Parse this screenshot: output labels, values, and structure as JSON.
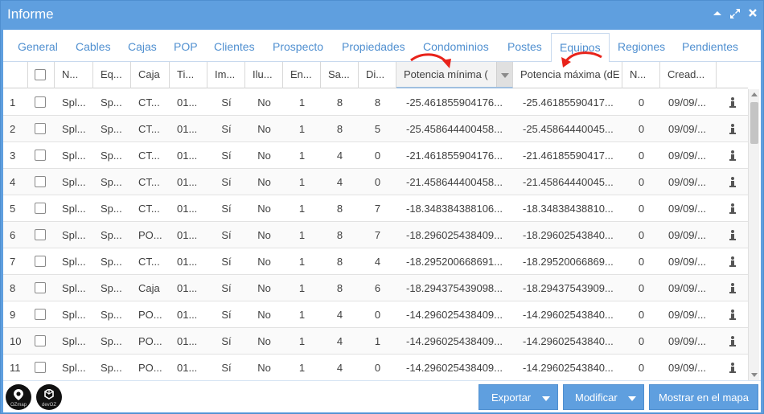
{
  "window": {
    "title": "Informe"
  },
  "titlebar_tools": [
    "collapse-icon",
    "expand-icon",
    "close-icon"
  ],
  "tabs": [
    "General",
    "Cables",
    "Cajas",
    "POP",
    "Clientes",
    "Prospecto",
    "Propiedades",
    "Condominios",
    "Postes",
    "Equipos",
    "Regiones",
    "Pendientes"
  ],
  "active_tab": "Equipos",
  "columns": [
    "N...",
    "Eq...",
    "Caja",
    "Ti...",
    "Im...",
    "Ilu...",
    "En...",
    "Sa...",
    "Di...",
    "Potencia mínima (",
    "Potencia máxima (dE",
    "N...",
    "Cread..."
  ],
  "rows": [
    [
      "1",
      "Spl...",
      "Sp...",
      "CT...",
      "01...",
      "Sí",
      "No",
      "1",
      "8",
      "8",
      "-25.461855904176...",
      "-25.46185590417...",
      "0",
      "09/09/..."
    ],
    [
      "2",
      "Spl...",
      "Sp...",
      "CT...",
      "01...",
      "Sí",
      "No",
      "1",
      "8",
      "5",
      "-25.458644400458...",
      "-25.45864440045...",
      "0",
      "09/09/..."
    ],
    [
      "3",
      "Spl...",
      "Sp...",
      "CT...",
      "01...",
      "Sí",
      "No",
      "1",
      "4",
      "0",
      "-21.461855904176...",
      "-21.46185590417...",
      "0",
      "09/09/..."
    ],
    [
      "4",
      "Spl...",
      "Sp...",
      "CT...",
      "01...",
      "Sí",
      "No",
      "1",
      "4",
      "0",
      "-21.458644400458...",
      "-21.45864440045...",
      "0",
      "09/09/..."
    ],
    [
      "5",
      "Spl...",
      "Sp...",
      "CT...",
      "01...",
      "Sí",
      "No",
      "1",
      "8",
      "7",
      "-18.348384388106...",
      "-18.34838438810...",
      "0",
      "09/09/..."
    ],
    [
      "6",
      "Spl...",
      "Sp...",
      "PO...",
      "01...",
      "Sí",
      "No",
      "1",
      "8",
      "7",
      "-18.296025438409...",
      "-18.29602543840...",
      "0",
      "09/09/..."
    ],
    [
      "7",
      "Spl...",
      "Sp...",
      "CT...",
      "01...",
      "Sí",
      "No",
      "1",
      "8",
      "4",
      "-18.295200668691...",
      "-18.29520066869...",
      "0",
      "09/09/..."
    ],
    [
      "8",
      "Spl...",
      "Sp...",
      "Caja",
      "01...",
      "Sí",
      "No",
      "1",
      "8",
      "6",
      "-18.294375439098...",
      "-18.29437543909...",
      "0",
      "09/09/..."
    ],
    [
      "9",
      "Spl...",
      "Sp...",
      "PO...",
      "01...",
      "Sí",
      "No",
      "1",
      "4",
      "0",
      "-14.296025438409...",
      "-14.29602543840...",
      "0",
      "09/09/..."
    ],
    [
      "10",
      "Spl...",
      "Sp...",
      "PO...",
      "01...",
      "Sí",
      "No",
      "1",
      "4",
      "1",
      "-14.296025438409...",
      "-14.29602543840...",
      "0",
      "09/09/..."
    ],
    [
      "11",
      "Spl...",
      "Sp...",
      "PO...",
      "01...",
      "Sí",
      "No",
      "1",
      "4",
      "0",
      "-14.296025438409...",
      "-14.29602543840...",
      "0",
      "09/09/..."
    ]
  ],
  "footer": {
    "logos": [
      "OZmap",
      "devOZ"
    ],
    "export_label": "Exportar",
    "modify_label": "Modificar",
    "map_label": "Mostrar en el mapa"
  },
  "colors": {
    "accent": "#5f9fdf",
    "tab_text": "#4f8fd0",
    "annotation_arrow": "#e8231a"
  }
}
